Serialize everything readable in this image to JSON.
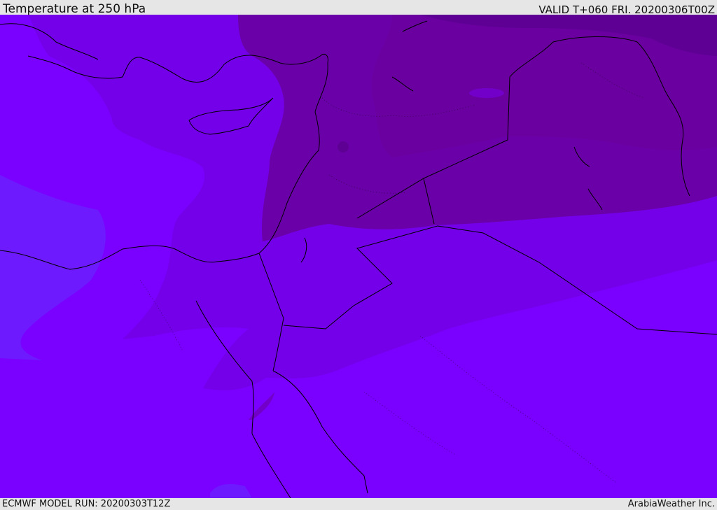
{
  "header": {
    "title": "Temperature at 250 hPa",
    "valid": "VALID T+060 FRI. 20200306T00Z"
  },
  "footer": {
    "model_run": "ECMWF MODEL RUN: 20200303T12Z",
    "credit": "ArabiaWeather Inc."
  },
  "map": {
    "field": "temperature",
    "level": "250 hPa",
    "colors": {
      "coldest": "#5e0094",
      "colder": "#6a00a8",
      "cold": "#7300c8",
      "cool": "#7a00e8",
      "base": "#7a00ff",
      "warm": "#6e1aff",
      "warmer": "#6230ff",
      "coastline": "#000000"
    }
  }
}
